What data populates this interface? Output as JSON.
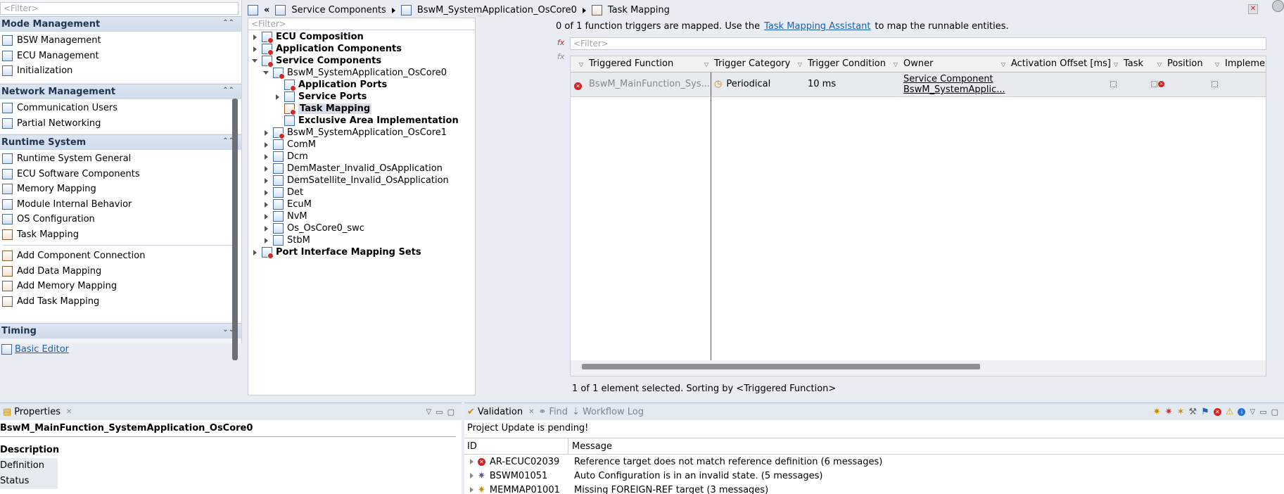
{
  "left": {
    "filter_placeholder": "<Filter>",
    "sections": [
      {
        "title": "Mode Management",
        "items": [
          "BSW Management",
          "ECU Management",
          "Initialization"
        ]
      },
      {
        "title": "Network Management",
        "items": [
          "Communication Users",
          "Partial Networking"
        ]
      },
      {
        "title": "Runtime System",
        "items": [
          "Runtime System General",
          "ECU Software Components",
          "Memory Mapping",
          "Module Internal Behavior",
          "OS Configuration",
          "Task Mapping"
        ],
        "actions": [
          "Add Component Connection",
          "Add Data Mapping",
          "Add Memory Mapping",
          "Add Task Mapping"
        ]
      },
      {
        "title": "Timing",
        "items": []
      }
    ],
    "basic_editor": "Basic Editor"
  },
  "breadcrumb": [
    "Service Components",
    "BswM_SystemApplication_OsCore0",
    "Task Mapping"
  ],
  "tree": {
    "filter_placeholder": "<Filter>",
    "nodes": [
      {
        "label": "ECU Composition"
      },
      {
        "label": "Application Components"
      },
      {
        "label": "Service Components"
      },
      {
        "label": "BswM_SystemApplication_OsCore0"
      },
      {
        "label": "Application Ports"
      },
      {
        "label": "Service Ports"
      },
      {
        "label": "Task Mapping"
      },
      {
        "label": "Exclusive Area Implementation"
      },
      {
        "label": "BswM_SystemApplication_OsCore1"
      },
      {
        "label": "ComM"
      },
      {
        "label": "Dcm"
      },
      {
        "label": "DemMaster_Invalid_OsApplication"
      },
      {
        "label": "DemSatellite_Invalid_OsApplication"
      },
      {
        "label": "Det"
      },
      {
        "label": "EcuM"
      },
      {
        "label": "NvM"
      },
      {
        "label": "Os_OsCore0_swc"
      },
      {
        "label": "StbM"
      },
      {
        "label": "Port Interface Mapping Sets"
      }
    ]
  },
  "mapping": {
    "status_prefix": "0 of 1 function triggers are mapped. Use the",
    "assistant_link": "Task Mapping Assistant",
    "status_suffix": "to map the runnable entities.",
    "grid_filter_placeholder": "<Filter>",
    "columns": [
      "Triggered Function",
      "Trigger Category",
      "Trigger Condition",
      "Owner",
      "Activation Offset [ms]",
      "Task",
      "Position",
      "Implemen"
    ],
    "row": {
      "triggered_function": "BswM_MainFunction_Sys...",
      "trigger_category": "Periodical",
      "trigger_condition": "10 ms",
      "owner_line1": "Service Component",
      "owner_line2": "BswM_SystemApplic..."
    },
    "footer": "1 of 1 element selected. Sorting by <Triggered Function>"
  },
  "properties": {
    "tab": "Properties",
    "title": "BswM_MainFunction_SystemApplication_OsCore0",
    "sections": [
      "Description",
      "Definition",
      "Status"
    ]
  },
  "validation": {
    "tabs": [
      "Validation",
      "Find",
      "Workflow Log"
    ],
    "pending": "Project Update is pending!",
    "columns": [
      "ID",
      "Message"
    ],
    "rows": [
      {
        "id": "AR-ECUC02039",
        "message": "Reference target does not match reference definition (6 messages)"
      },
      {
        "id": "BSWM01051",
        "message": "Auto Configuration is in an invalid state. (5 messages)"
      },
      {
        "id": "MEMMAP01001",
        "message": "Missing FOREIGN-REF target (3 messages)"
      }
    ]
  },
  "colors": {
    "link": "#1a5fb4",
    "error": "#d42121",
    "header_blue": "#cfdbea"
  }
}
